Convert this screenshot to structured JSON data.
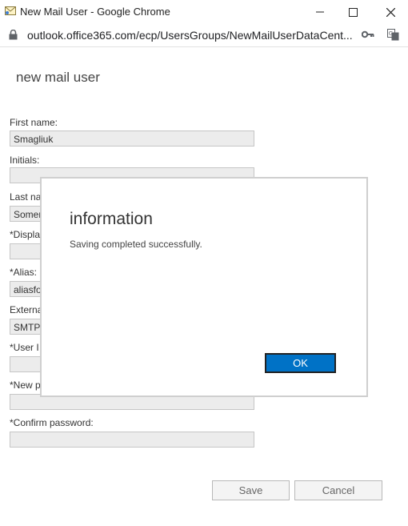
{
  "window": {
    "title": "New Mail User - Google Chrome",
    "url": "outlook.office365.com/ecp/UsersGroups/NewMailUserDataCent..."
  },
  "page": {
    "title": "new mail user"
  },
  "form": {
    "first_name_label": "First name:",
    "first_name_value": "Smagliuk",
    "initials_label": "Initials:",
    "initials_value": "",
    "last_name_label": "Last na",
    "last_name_value": "Somer",
    "display_label": "*Displa",
    "display_value": "",
    "alias_label": "*Alias:",
    "alias_value": "aliasfo",
    "external_label": "Externa",
    "external_value": "SMTP:",
    "userid_label": "*User I",
    "userid_value": "",
    "new_password_label": "*New p",
    "new_password_value": "",
    "confirm_password_label": "*Confirm password:",
    "confirm_password_value": ""
  },
  "buttons": {
    "save": "Save",
    "cancel": "Cancel"
  },
  "dialog": {
    "title": "information",
    "message": "Saving completed successfully.",
    "ok": "OK"
  },
  "colors": {
    "ok_button": "#0072c6",
    "field_bg": "#ececec"
  }
}
